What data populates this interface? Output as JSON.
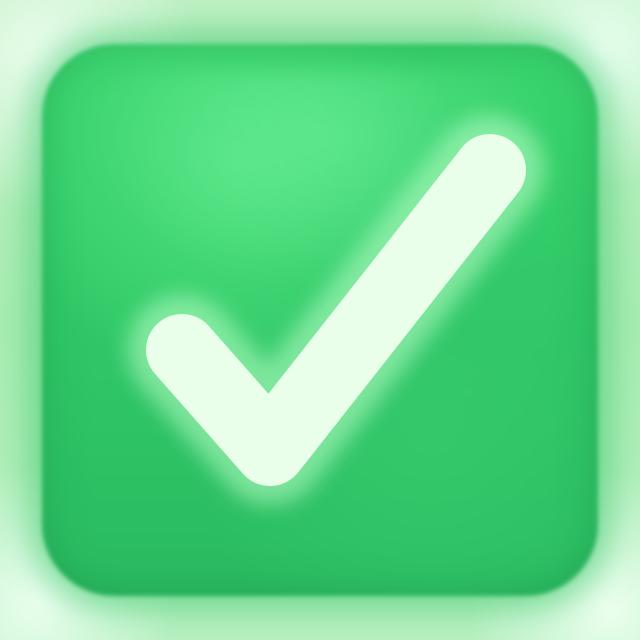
{
  "icon": {
    "name": "checkbox-checked-icon",
    "colors": {
      "tile": "#2fc766",
      "tile_highlight": "#4ee07f",
      "check": "#e9ffe9",
      "glow": "#bff0c4"
    }
  }
}
